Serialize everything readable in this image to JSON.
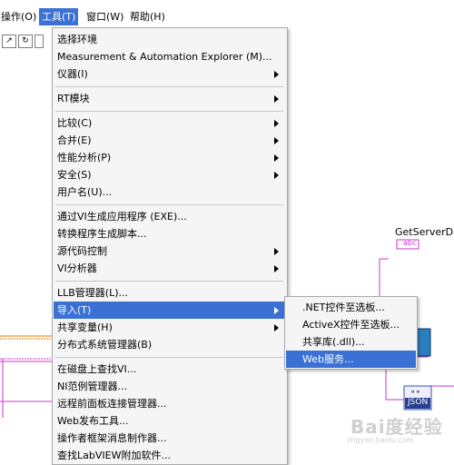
{
  "menubar": {
    "items": [
      {
        "label": "操作(O)"
      },
      {
        "label": "工具(T)"
      },
      {
        "label": "窗口(W)"
      },
      {
        "label": "帮助(H)"
      }
    ]
  },
  "tools_menu": {
    "items": [
      {
        "label": "选择环境",
        "submenu": false
      },
      {
        "label": "Measurement & Automation Explorer (M)...",
        "submenu": false
      },
      {
        "label": "仪器(I)",
        "submenu": true
      },
      {
        "label": "RT模块",
        "submenu": true
      },
      {
        "label": "比较(C)",
        "submenu": true
      },
      {
        "label": "合并(E)",
        "submenu": true
      },
      {
        "label": "性能分析(P)",
        "submenu": true
      },
      {
        "label": "安全(S)",
        "submenu": true
      },
      {
        "label": "用户名(U)...",
        "submenu": false
      },
      {
        "label": "通过VI生成应用程序 (EXE)...",
        "submenu": false
      },
      {
        "label": "转换程序生成脚本...",
        "submenu": false
      },
      {
        "label": "源代码控制",
        "submenu": true
      },
      {
        "label": "VI分析器",
        "submenu": true
      },
      {
        "label": "LLB管理器(L)...",
        "submenu": false
      },
      {
        "label": "导入(T)",
        "submenu": true,
        "highlighted": true
      },
      {
        "label": "共享变量(H)",
        "submenu": true
      },
      {
        "label": "分布式系统管理器(B)",
        "submenu": false
      },
      {
        "label": "在磁盘上查找VI...",
        "submenu": false
      },
      {
        "label": "NI范例管理器...",
        "submenu": false
      },
      {
        "label": "远程前面板连接管理器...",
        "submenu": false
      },
      {
        "label": "Web发布工具...",
        "submenu": false
      },
      {
        "label": "操作者框架消息制作器...",
        "submenu": false
      },
      {
        "label": "查找LabVIEW附加软件...",
        "submenu": false
      }
    ]
  },
  "import_submenu": {
    "items": [
      {
        "label": ".NET控件至选板..."
      },
      {
        "label": "ActiveX控件至选板..."
      },
      {
        "label": "共享库(.dll)..."
      },
      {
        "label": "Web服务...",
        "highlighted": true
      }
    ]
  },
  "background": {
    "node_label": "GetServerDa",
    "string_const": "abc",
    "json_label": "JSON"
  },
  "watermark": {
    "main": "Bai度经验",
    "sub": "jingyan.baidu.com"
  },
  "colors": {
    "highlight": "#3b71d4",
    "wire_pink": "#cc33cc",
    "wire_orange": "#e07800"
  }
}
